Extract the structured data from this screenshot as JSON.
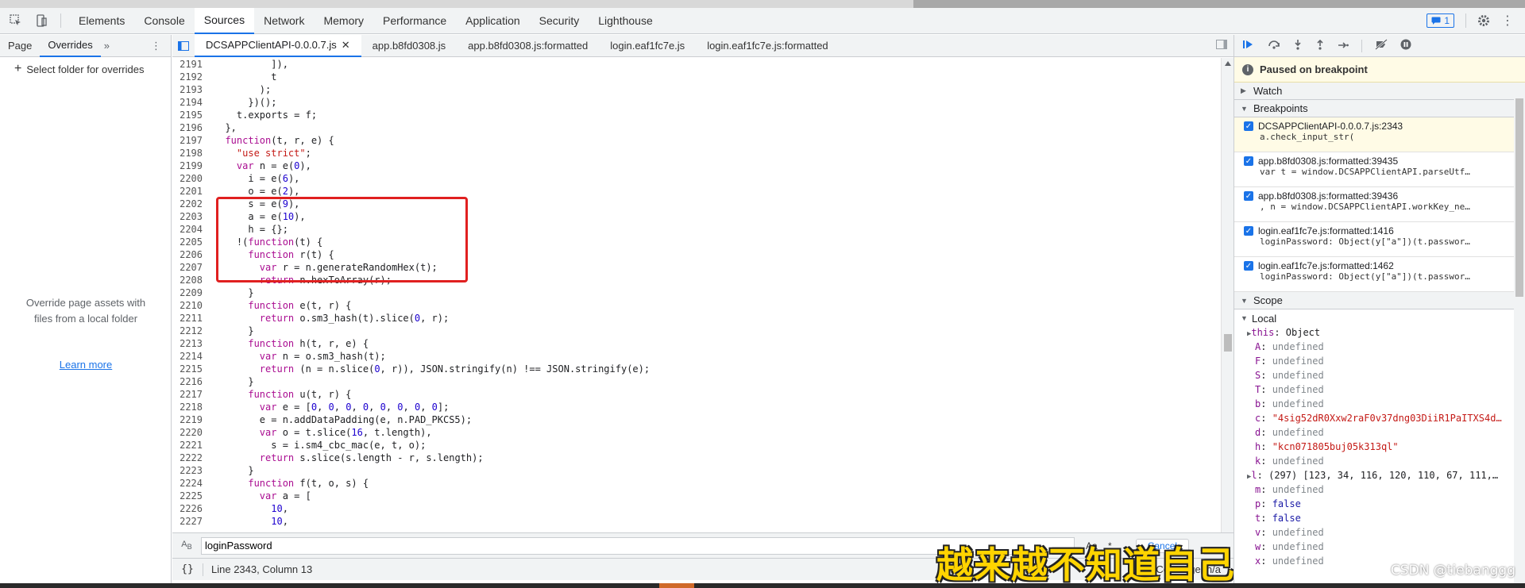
{
  "main_tabs": [
    "Elements",
    "Console",
    "Sources",
    "Network",
    "Memory",
    "Performance",
    "Application",
    "Security",
    "Lighthouse"
  ],
  "active_main_tab": "Sources",
  "issues_count": "1",
  "left": {
    "tabs": [
      "Page",
      "Overrides"
    ],
    "select_folder": "Select folder for overrides",
    "message": "Override page assets with files from a local folder",
    "learn_more": "Learn more"
  },
  "file_tabs": [
    "DCSAPPClientAPI-0.0.0.7.js",
    "app.b8fd0308.js",
    "app.b8fd0308.js:formatted",
    "login.eaf1fc7e.js",
    "login.eaf1fc7e.js:formatted"
  ],
  "code_lines": [
    {
      "n": "2191",
      "t": "          ]),"
    },
    {
      "n": "2192",
      "t": "          t"
    },
    {
      "n": "2193",
      "t": "        );"
    },
    {
      "n": "2194",
      "t": "      })();"
    },
    {
      "n": "2195",
      "t": "    t.exports = f;"
    },
    {
      "n": "2196",
      "t": "  },"
    },
    {
      "n": "2197",
      "t": "  function(t, r, e) {"
    },
    {
      "n": "2198",
      "t": "    \"use strict\";"
    },
    {
      "n": "2199",
      "t": "    var n = e(0),"
    },
    {
      "n": "2200",
      "t": "      i = e(6),"
    },
    {
      "n": "2201",
      "t": "      o = e(2),"
    },
    {
      "n": "2202",
      "t": "      s = e(9),"
    },
    {
      "n": "2203",
      "t": "      a = e(10),"
    },
    {
      "n": "2204",
      "t": "      h = {};"
    },
    {
      "n": "2205",
      "t": "    !(function(t) {"
    },
    {
      "n": "2206",
      "t": "      function r(t) {"
    },
    {
      "n": "2207",
      "t": "        var r = n.generateRandomHex(t);"
    },
    {
      "n": "2208",
      "t": "        return n.hexToArray(r);"
    },
    {
      "n": "2209",
      "t": "      }"
    },
    {
      "n": "2210",
      "t": "      function e(t, r) {"
    },
    {
      "n": "2211",
      "t": "        return o.sm3_hash(t).slice(0, r);"
    },
    {
      "n": "2212",
      "t": "      }"
    },
    {
      "n": "2213",
      "t": "      function h(t, r, e) {"
    },
    {
      "n": "2214",
      "t": "        var n = o.sm3_hash(t);"
    },
    {
      "n": "2215",
      "t": "        return (n = n.slice(0, r)), JSON.stringify(n) !== JSON.stringify(e);"
    },
    {
      "n": "2216",
      "t": "      }"
    },
    {
      "n": "2217",
      "t": "      function u(t, r) {"
    },
    {
      "n": "2218",
      "t": "        var e = [0, 0, 0, 0, 0, 0, 0, 0];"
    },
    {
      "n": "2219",
      "t": "        e = n.addDataPadding(e, n.PAD_PKCS5);"
    },
    {
      "n": "2220",
      "t": "        var o = t.slice(16, t.length),"
    },
    {
      "n": "2221",
      "t": "          s = i.sm4_cbc_mac(e, t, o);"
    },
    {
      "n": "2222",
      "t": "        return s.slice(s.length - r, s.length);"
    },
    {
      "n": "2223",
      "t": "      }"
    },
    {
      "n": "2224",
      "t": "      function f(t, o, s) {"
    },
    {
      "n": "2225",
      "t": "        var a = ["
    },
    {
      "n": "2226",
      "t": "          10,"
    },
    {
      "n": "2227",
      "t": "          10,"
    }
  ],
  "search": {
    "value": "loginPassword",
    "aa": "Aa",
    "regex": ".*",
    "cancel": "Cancel"
  },
  "status": {
    "braces": "{}",
    "position": "Line 2343, Column 13",
    "coverage": "Coverage: n/a"
  },
  "subtitle": "越来越不知道自己要的是什么",
  "debugger": {
    "paused": "Paused on breakpoint",
    "watch": "Watch",
    "breakpoints_title": "Breakpoints",
    "breakpoints": [
      {
        "loc": "DCSAPPClientAPI-0.0.0.7.js:2343",
        "code": "a.check_input_str("
      },
      {
        "loc": "app.b8fd0308.js:formatted:39435",
        "code": "var t = window.DCSAPPClientAPI.parseUtf…"
      },
      {
        "loc": "app.b8fd0308.js:formatted:39436",
        "code": ", n = window.DCSAPPClientAPI.workKey_ne…"
      },
      {
        "loc": "login.eaf1fc7e.js:formatted:1416",
        "code": "loginPassword: Object(y[\"a\"])(t.passwor…"
      },
      {
        "loc": "login.eaf1fc7e.js:formatted:1462",
        "code": "loginPassword: Object(y[\"a\"])(t.passwor…"
      }
    ],
    "scope_title": "Scope",
    "local_title": "Local",
    "vars": [
      {
        "name": "this",
        "value": "Object",
        "kind": "obj",
        "expand": true
      },
      {
        "name": "A",
        "value": "undefined",
        "kind": "undef"
      },
      {
        "name": "F",
        "value": "undefined",
        "kind": "undef"
      },
      {
        "name": "S",
        "value": "undefined",
        "kind": "undef"
      },
      {
        "name": "T",
        "value": "undefined",
        "kind": "undef"
      },
      {
        "name": "b",
        "value": "undefined",
        "kind": "undef"
      },
      {
        "name": "c",
        "value": "\"4sig52dR0Xxw2raF0v37dng03DiiR1PaITXS4d…",
        "kind": "str"
      },
      {
        "name": "d",
        "value": "undefined",
        "kind": "undef"
      },
      {
        "name": "h",
        "value": "\"kcn071805buj05k313ql\"",
        "kind": "str"
      },
      {
        "name": "k",
        "value": "undefined",
        "kind": "undef"
      },
      {
        "name": "l",
        "value": "(297) [123, 34, 116, 120, 110, 67, 111,…",
        "kind": "obj",
        "expand": true
      },
      {
        "name": "m",
        "value": "undefined",
        "kind": "undef"
      },
      {
        "name": "p",
        "value": "false",
        "kind": "bool"
      },
      {
        "name": "t",
        "value": "false",
        "kind": "bool"
      },
      {
        "name": "v",
        "value": "undefined",
        "kind": "undef"
      },
      {
        "name": "w",
        "value": "undefined",
        "kind": "undef"
      },
      {
        "name": "x",
        "value": "undefined",
        "kind": "undef"
      }
    ]
  },
  "watermark": "CSDN @tiebanggg"
}
